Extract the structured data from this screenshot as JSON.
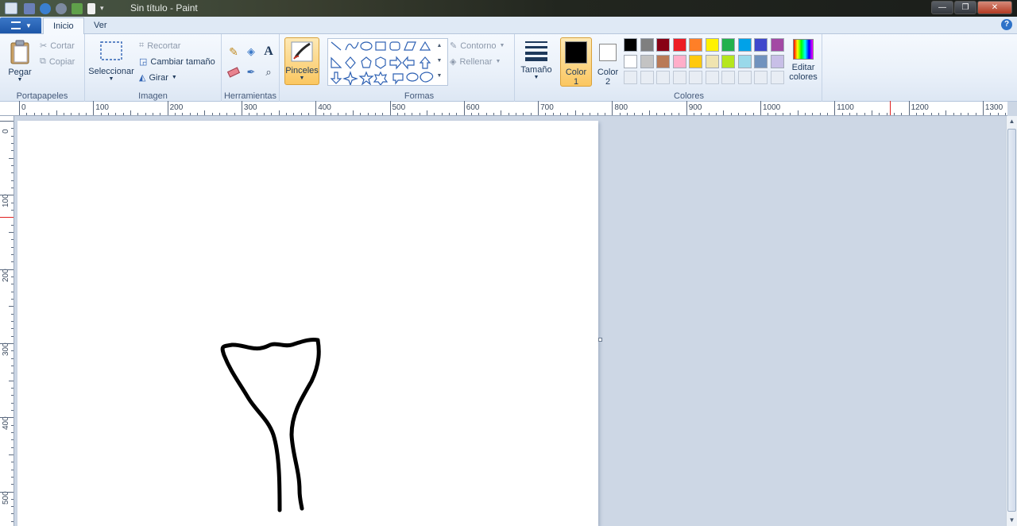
{
  "window": {
    "title": "Sin título - Paint"
  },
  "tabs": [
    {
      "label": "Inicio",
      "active": true
    },
    {
      "label": "Ver",
      "active": false
    }
  ],
  "ribbon": {
    "portapapeles": {
      "label": "Portapapeles",
      "paste": "Pegar",
      "cut": "Cortar",
      "copy": "Copiar"
    },
    "imagen": {
      "label": "Imagen",
      "select": "Seleccionar",
      "crop": "Recortar",
      "resize": "Cambiar tamaño",
      "rotate": "Girar"
    },
    "herramientas": {
      "label": "Herramientas"
    },
    "pinceles": {
      "label": "Pinceles"
    },
    "formas": {
      "label": "Formas",
      "outline": "Contorno",
      "fill": "Rellenar"
    },
    "tamano": {
      "label": "Tamaño"
    },
    "color1": {
      "line1": "Color",
      "line2": "1",
      "value": "#000000"
    },
    "color2": {
      "line1": "Color",
      "line2": "2",
      "value": "#ffffff"
    },
    "colores": {
      "label": "Colores",
      "edit_line1": "Editar",
      "edit_line2": "colores",
      "row1": [
        "#000000",
        "#7f7f7f",
        "#880015",
        "#ed1c24",
        "#ff7f27",
        "#fff200",
        "#22b14c",
        "#00a2e8",
        "#3f48cc",
        "#a349a4"
      ],
      "row2": [
        "#ffffff",
        "#c3c3c3",
        "#b97a57",
        "#ffaec9",
        "#ffc90e",
        "#efe4b0",
        "#b5e61d",
        "#99d9ea",
        "#7092be",
        "#c8bfe7"
      ]
    }
  },
  "rulers": {
    "horizontal": [
      "0",
      "100",
      "200",
      "300",
      "400",
      "500",
      "600",
      "700",
      "800",
      "900",
      "1000",
      "1100",
      "1200",
      "1300"
    ],
    "vertical": [
      "0",
      "100",
      "200",
      "300",
      "400",
      "500"
    ]
  }
}
